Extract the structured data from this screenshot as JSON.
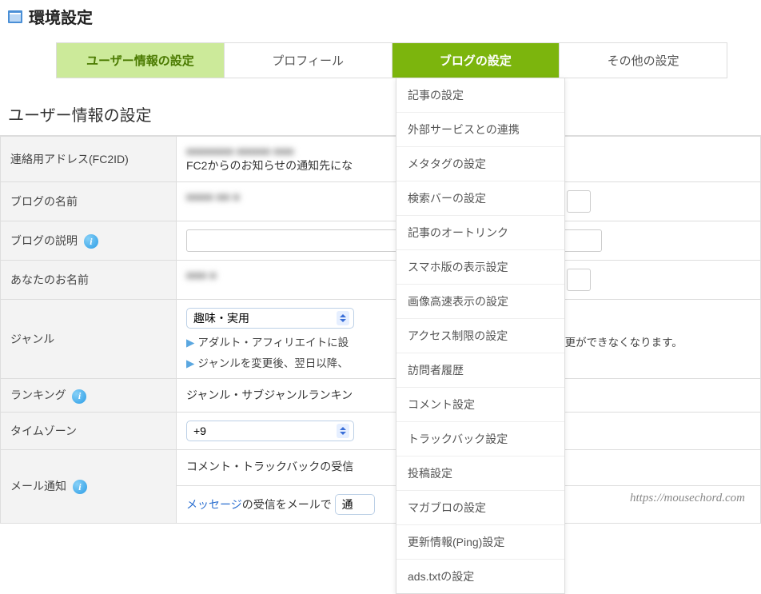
{
  "header": {
    "title": "環境設定"
  },
  "tabs": {
    "user": "ユーザー情報の設定",
    "profile": "プロフィール",
    "blog": "ブログの設定",
    "other": "その他の設定"
  },
  "section_title": "ユーザー情報の設定",
  "rows": {
    "contact": {
      "label": "連絡用アドレス(FC2ID)",
      "masked": "■■■■■■■ ■■■■■ ■■■",
      "desc": "FC2からのお知らせの通知先にな"
    },
    "blogname": {
      "label": "ブログの名前",
      "masked": "■■■■ ■■ ■"
    },
    "blogdesc": {
      "label": "ブログの説明"
    },
    "yourname": {
      "label": "あなたのお名前",
      "masked": "■■■ ■"
    },
    "genre": {
      "label": "ジャンル",
      "select": "趣味・実用",
      "note1": "アダルト・アフィリエイトに設",
      "note2": "ジャンルを変更後、翌日以降、",
      "note_tail": "ルが変更ができなくなります。"
    },
    "ranking": {
      "label": "ランキング",
      "desc": "ジャンル・サブジャンルランキン"
    },
    "timezone": {
      "label": "タイムゾーン",
      "value": "+9"
    },
    "mail": {
      "label": "メール通知",
      "line1": "コメント・トラックバックの受信",
      "line2a": "メッセージ",
      "line2b": "の受信をメールで",
      "select2": "通"
    }
  },
  "dropdown": [
    "記事の設定",
    "外部サービスとの連携",
    "メタタグの設定",
    "検索バーの設定",
    "記事のオートリンク",
    "スマホ版の表示設定",
    "画像高速表示の設定",
    "アクセス制限の設定",
    "訪問者履歴",
    "コメント設定",
    "トラックバック設定",
    "投稿設定",
    "マガブロの設定",
    "更新情報(Ping)設定",
    "ads.txtの設定"
  ],
  "watermark": "https://mousechord.com"
}
